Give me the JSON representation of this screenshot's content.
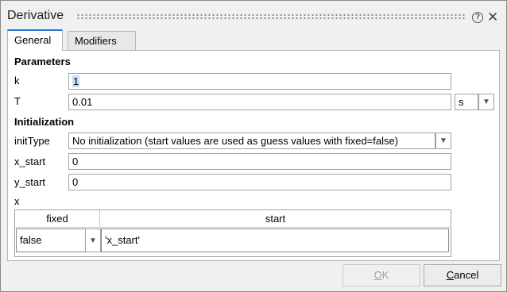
{
  "window": {
    "title": "Derivative"
  },
  "tabs": [
    {
      "label": "General"
    },
    {
      "label": "Modifiers"
    }
  ],
  "parameters": {
    "heading": "Parameters",
    "k": {
      "label": "k",
      "value": "1"
    },
    "T": {
      "label": "T",
      "value": "0.01",
      "unit": "s"
    }
  },
  "initialization": {
    "heading": "Initialization",
    "initType": {
      "label": "initType",
      "value": "No initialization (start values are used as guess values with fixed=false)"
    },
    "x_start": {
      "label": "x_start",
      "value": "0"
    },
    "y_start": {
      "label": "y_start",
      "value": "0"
    },
    "x": {
      "label": "x",
      "columns": [
        "fixed",
        "start"
      ],
      "rows": [
        {
          "fixed": "false",
          "start": "'x_start'"
        }
      ]
    }
  },
  "buttons": {
    "ok_prefix": "",
    "ok_underlined": "O",
    "ok_rest": "K",
    "cancel_underlined": "C",
    "cancel_rest": "ancel"
  },
  "icons": {
    "help": "help-icon",
    "close": "close-icon",
    "dropdown": "chevron-down-icon"
  }
}
